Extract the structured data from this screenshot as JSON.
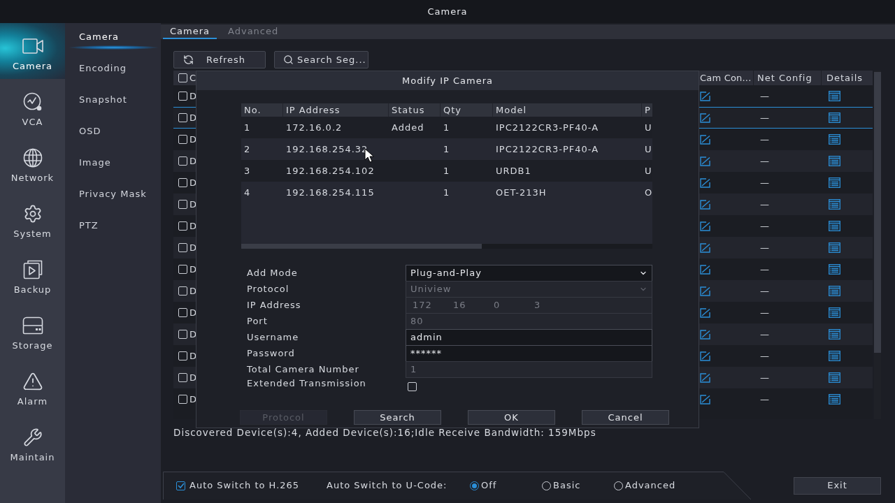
{
  "window": {
    "title": "Camera"
  },
  "nav": [
    {
      "label": "Camera",
      "selected": true
    },
    {
      "label": "VCA",
      "selected": false
    },
    {
      "label": "Network",
      "selected": false
    },
    {
      "label": "System",
      "selected": false
    },
    {
      "label": "Backup",
      "selected": false
    },
    {
      "label": "Storage",
      "selected": false
    },
    {
      "label": "Alarm",
      "selected": false
    },
    {
      "label": "Maintain",
      "selected": false
    }
  ],
  "submenu": [
    {
      "label": "Camera",
      "selected": true
    },
    {
      "label": "Encoding",
      "selected": false
    },
    {
      "label": "Snapshot",
      "selected": false
    },
    {
      "label": "OSD",
      "selected": false
    },
    {
      "label": "Image",
      "selected": false
    },
    {
      "label": "Privacy Mask",
      "selected": false
    },
    {
      "label": "PTZ",
      "selected": false
    }
  ],
  "tabs": [
    {
      "label": "Camera",
      "selected": true
    },
    {
      "label": "Advanced",
      "selected": false
    }
  ],
  "toolbar": [
    {
      "label": "Refresh"
    },
    {
      "label": "Search Seg..."
    }
  ],
  "device_table": {
    "header_checked": false,
    "columns": [
      "C",
      "Cam Con...",
      "Net Config",
      "Details"
    ],
    "rows": [
      {
        "checked": false,
        "selected": false,
        "column_2": "D",
        "net_config": "—"
      },
      {
        "checked": false,
        "selected": true,
        "column_2": "D",
        "net_config": "—"
      },
      {
        "checked": false,
        "selected": false,
        "column_2": "D",
        "net_config": "—"
      },
      {
        "checked": false,
        "selected": false,
        "column_2": "D",
        "net_config": "—"
      },
      {
        "checked": false,
        "selected": false,
        "column_2": "D",
        "net_config": "—"
      },
      {
        "checked": false,
        "selected": false,
        "column_2": "D",
        "net_config": "—"
      },
      {
        "checked": false,
        "selected": false,
        "column_2": "D",
        "net_config": "—"
      },
      {
        "checked": false,
        "selected": false,
        "column_2": "D",
        "net_config": "—"
      },
      {
        "checked": false,
        "selected": false,
        "column_2": "D",
        "net_config": "—"
      },
      {
        "checked": false,
        "selected": false,
        "column_2": "D",
        "net_config": "—"
      },
      {
        "checked": false,
        "selected": false,
        "column_2": "D",
        "net_config": "—"
      },
      {
        "checked": false,
        "selected": false,
        "column_2": "D",
        "net_config": "—"
      },
      {
        "checked": false,
        "selected": false,
        "column_2": "D",
        "net_config": "—"
      },
      {
        "checked": false,
        "selected": false,
        "column_2": "D",
        "net_config": "—"
      },
      {
        "checked": false,
        "selected": false,
        "column_2": "D",
        "net_config": "—"
      }
    ]
  },
  "dialog": {
    "title": "Modify IP Camera",
    "table": {
      "columns": [
        "No.",
        "IP Address",
        "Status",
        "Qty",
        "Model",
        "P"
      ],
      "rows": [
        {
          "no": "1",
          "ip_address": "172.16.0.2",
          "status": "Added",
          "qty": "1",
          "model": "IPC2122CR3-PF40-A",
          "column_6": "U"
        },
        {
          "no": "2",
          "ip_address": "192.168.254.32",
          "qty": "1",
          "model": "IPC2122CR3-PF40-A",
          "column_6": "U"
        },
        {
          "no": "3",
          "ip_address": "192.168.254.102",
          "qty": "1",
          "model": "URDB1",
          "column_6": "U"
        },
        {
          "no": "4",
          "ip_address": "192.168.254.115",
          "qty": "1",
          "model": "OET-213H",
          "column_6": "O"
        }
      ]
    },
    "form": [
      {
        "kind": "select",
        "label": "Add Mode",
        "value": "Plug-and-Play",
        "disabled": false
      },
      {
        "kind": "select",
        "label": "Protocol",
        "value": "Uniview",
        "disabled": true
      },
      {
        "kind": "ip",
        "label": "IP Address",
        "segments": [
          "172",
          "16",
          "0",
          "3"
        ],
        "disabled": true
      },
      {
        "kind": "text",
        "label": "Port",
        "value": "80",
        "disabled": true
      },
      {
        "kind": "text",
        "label": "Username",
        "value": "admin",
        "disabled": false
      },
      {
        "kind": "password",
        "label": "Password",
        "value": "******",
        "disabled": false
      },
      {
        "kind": "text",
        "label": "Total Camera Number",
        "value": "1",
        "disabled": true
      },
      {
        "kind": "checkbox",
        "label": "Extended Transmission",
        "checked": false
      }
    ],
    "buttons": [
      {
        "label": "Protocol",
        "disabled": true
      },
      {
        "label": "Search",
        "disabled": false
      },
      {
        "label": "OK",
        "disabled": false
      },
      {
        "label": "Cancel",
        "disabled": false
      }
    ]
  },
  "status": "Discovered Device(s):4, Added Device(s):16;Idle Receive Bandwidth: 159Mbps",
  "bottom_bar": {
    "h265": {
      "label": "Auto Switch to H.265",
      "checked": true
    },
    "ucode_label": "Auto Switch to U-Code:",
    "ucode_options": [
      {
        "label": "Off",
        "selected": true
      },
      {
        "label": "Basic",
        "selected": false
      },
      {
        "label": "Advanced",
        "selected": false
      }
    ]
  },
  "exit_button": {
    "label": "Exit"
  }
}
